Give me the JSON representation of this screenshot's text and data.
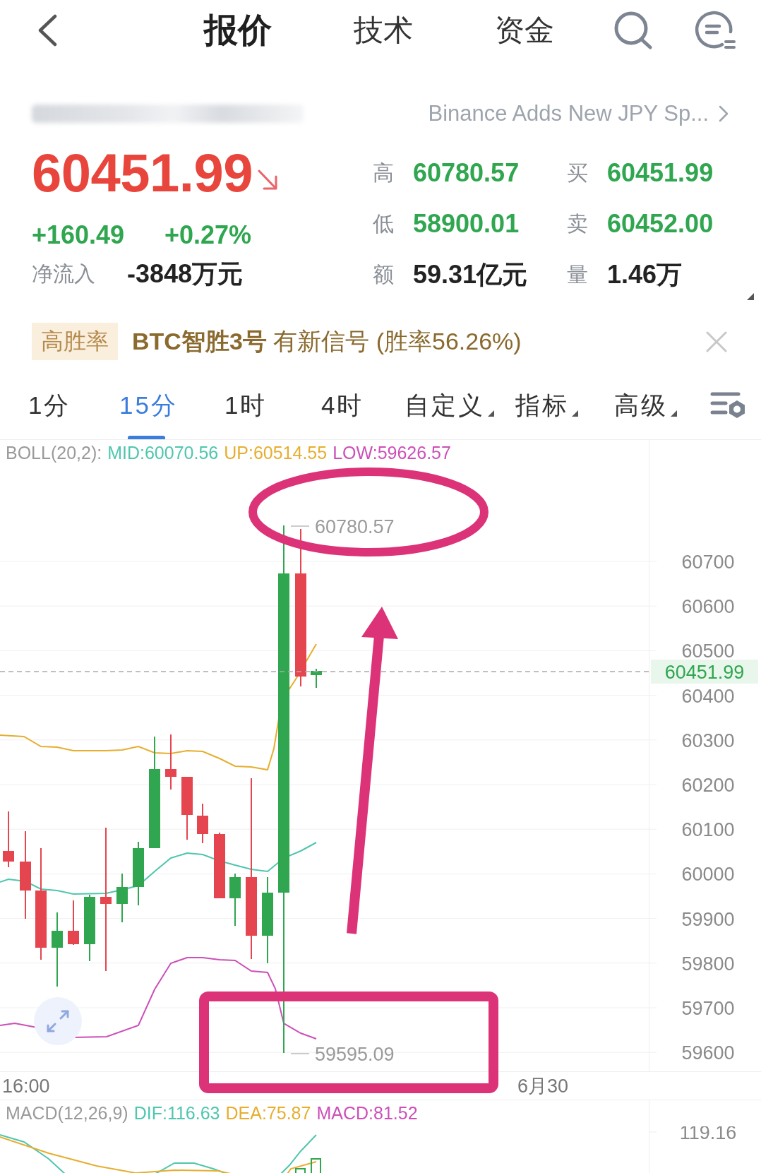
{
  "header": {
    "tabs": [
      {
        "label": "报价",
        "selected": true
      },
      {
        "label": "技术",
        "selected": false
      },
      {
        "label": "资金",
        "selected": false
      }
    ]
  },
  "news": {
    "headline": "Binance Adds New JPY Sp..."
  },
  "quote": {
    "price": "60451.99",
    "change": "+160.49",
    "change_percent": "+0.27%",
    "net_inflow": {
      "label": "净流入",
      "value": "-3848万元"
    }
  },
  "stats": [
    {
      "label": "高",
      "value": "60780.57",
      "kind": "price"
    },
    {
      "label": "买",
      "value": "60451.99",
      "kind": "price"
    },
    {
      "label": "低",
      "value": "58900.01",
      "kind": "price"
    },
    {
      "label": "卖",
      "value": "60452.00",
      "kind": "price"
    },
    {
      "label": "额",
      "value": "59.31亿元",
      "kind": "amount"
    },
    {
      "label": "量",
      "value": "1.46万",
      "kind": "amount"
    }
  ],
  "signal": {
    "tag": "高胜率",
    "text": "**BTC智胜3号** 有新信号 (胜率56.26%)"
  },
  "periods": [
    {
      "label": "1分",
      "selected": false,
      "has_menu": false
    },
    {
      "label": "15分",
      "selected": true,
      "has_menu": false
    },
    {
      "label": "1时",
      "selected": false,
      "has_menu": false
    },
    {
      "label": "4时",
      "selected": false,
      "has_menu": false
    },
    {
      "label": "自定义",
      "selected": false,
      "has_menu": true
    },
    {
      "label": "指标",
      "selected": false,
      "has_menu": true
    },
    {
      "label": "高级",
      "selected": false,
      "has_menu": true
    }
  ],
  "chart": {
    "legend": {
      "name": "BOLL(20,2):",
      "items": [
        {
          "label": "MID:60070.56",
          "color": "#4fc6ae"
        },
        {
          "label": "UP:60514.55",
          "color": "#e6ae2e"
        },
        {
          "label": "LOW:59626.57",
          "color": "#cc4fb8"
        }
      ]
    },
    "y_ticks": [
      "60700",
      "60600",
      "60500",
      "60400",
      "60300",
      "60200",
      "60100",
      "60000",
      "59900",
      "59800",
      "59700",
      "59600"
    ],
    "high_label": "60780.57",
    "low_label": "59595.09",
    "last_price": "60451.99",
    "x_labels": [
      "16:00",
      "6月30"
    ]
  },
  "macd": {
    "legend": {
      "name": "MACD(12,26,9)",
      "items": [
        {
          "label": "DIF:116.63",
          "color": "#4fc6ae"
        },
        {
          "label": "DEA:75.87",
          "color": "#e6ae2e"
        },
        {
          "label": "MACD:81.52",
          "color": "#cc4fb8"
        }
      ]
    },
    "y_tick": "119.16"
  }
}
